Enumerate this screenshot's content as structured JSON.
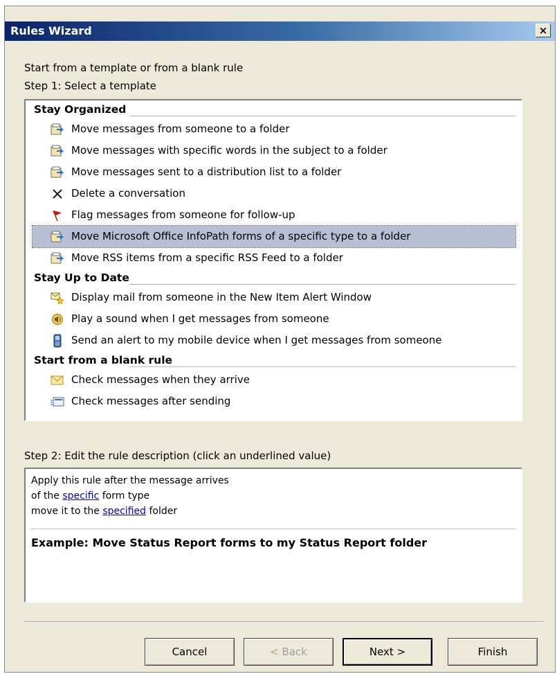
{
  "window": {
    "title": "Rules Wizard",
    "close_glyph": "×"
  },
  "intro": "Start from a template or from a blank rule",
  "step1": "Step 1: Select a template",
  "groups": [
    {
      "label": "Stay Organized",
      "items": [
        {
          "icon": "move-to-folder-icon",
          "text": "Move messages from someone to a folder"
        },
        {
          "icon": "move-to-folder-icon",
          "text": "Move messages with specific words in the subject to a folder"
        },
        {
          "icon": "move-to-folder-icon",
          "text": "Move messages sent to a distribution list to a folder"
        },
        {
          "icon": "delete-x-icon",
          "text": "Delete a conversation"
        },
        {
          "icon": "red-flag-icon",
          "text": "Flag messages from someone for follow-up"
        },
        {
          "icon": "move-to-folder-icon",
          "text": "Move Microsoft Office InfoPath forms of a specific type to a folder"
        },
        {
          "icon": "move-to-folder-icon",
          "text": "Move RSS items from a specific RSS Feed to a folder"
        }
      ]
    },
    {
      "label": "Stay Up to Date",
      "items": [
        {
          "icon": "new-item-alert-icon",
          "text": "Display mail from someone in the New Item Alert Window"
        },
        {
          "icon": "sound-icon",
          "text": "Play a sound when I get messages from someone"
        },
        {
          "icon": "mobile-device-icon",
          "text": "Send an alert to my mobile device when I get messages from someone"
        }
      ]
    },
    {
      "label": "Start from a blank rule",
      "items": [
        {
          "icon": "envelope-icon",
          "text": "Check messages when they arrive"
        },
        {
          "icon": "sent-message-icon",
          "text": "Check messages after sending"
        }
      ]
    }
  ],
  "step2": "Step 2: Edit the rule description (click an underlined value)",
  "description": {
    "line1": "Apply this rule after the message arrives",
    "line2_pre": "of the ",
    "line2_link": "specific",
    "line2_post": " form type",
    "line3_pre": "move it to the ",
    "line3_link": "specified",
    "line3_post": " folder",
    "example": "Example: Move Status Report forms to my Status Report folder"
  },
  "buttons": {
    "cancel": "Cancel",
    "back": "< Back",
    "next": "Next >",
    "finish": "Finish"
  }
}
